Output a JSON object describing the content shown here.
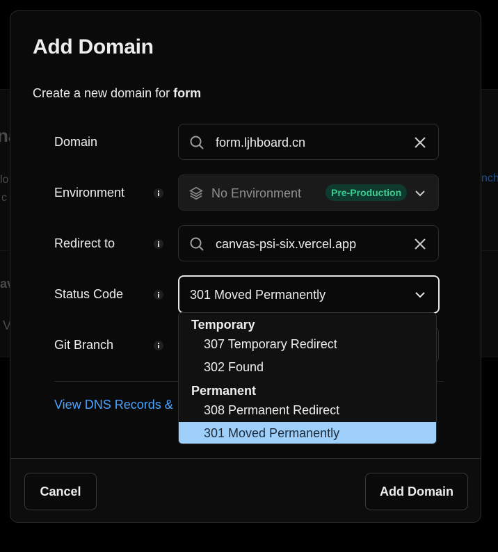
{
  "background": {
    "fragment_left_1": "na",
    "fragment_left_2": "lo",
    "fragment_left_3": "c",
    "fragment_left_4": "av",
    "fragment_left_5": "V",
    "fragment_right": "nch"
  },
  "modal": {
    "title": "Add Domain",
    "subtitle_prefix": "Create a new domain for",
    "subtitle_project": "form"
  },
  "form": {
    "domain": {
      "label": "Domain",
      "value": "form.ljhboard.cn"
    },
    "environment": {
      "label": "Environment",
      "value": "No Environment",
      "badge": "Pre-Production"
    },
    "redirect": {
      "label": "Redirect to",
      "value": "canvas-psi-six.vercel.app"
    },
    "status_code": {
      "label": "Status Code",
      "value": "301 Moved Permanently"
    },
    "git_branch": {
      "label": "Git Branch"
    }
  },
  "dropdown": {
    "groups": [
      {
        "label": "Temporary",
        "options": [
          "307 Temporary Redirect",
          "302 Found"
        ]
      },
      {
        "label": "Permanent",
        "options": [
          "308 Permanent Redirect",
          "301 Moved Permanently"
        ]
      }
    ],
    "selected": "301 Moved Permanently"
  },
  "dns_link": "View DNS Records &",
  "footer": {
    "cancel": "Cancel",
    "add": "Add Domain"
  },
  "colors": {
    "accent_link": "#4aa3ff",
    "selected_option": "#9fd0fb",
    "badge_bg": "#0e3a30",
    "badge_text": "#3ccf91"
  }
}
